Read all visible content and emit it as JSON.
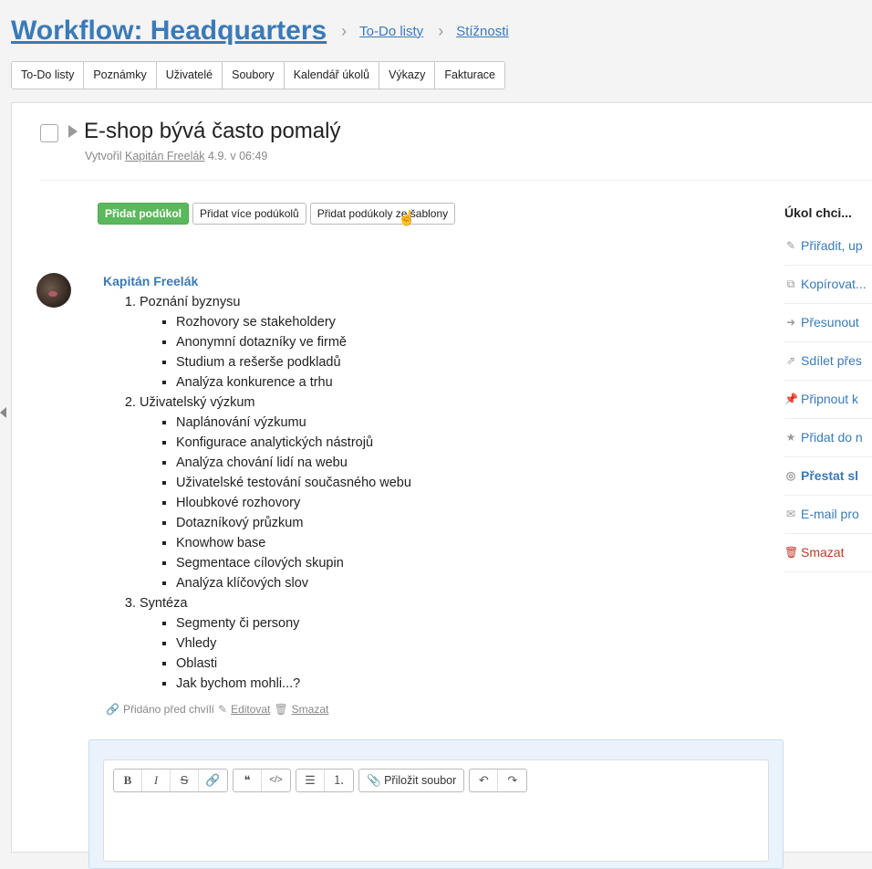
{
  "header": {
    "title": "Workflow: Headquarters",
    "breadcrumbs": [
      "To-Do listy",
      "Stížnosti"
    ]
  },
  "tabs": [
    "To-Do listy",
    "Poznámky",
    "Uživatelé",
    "Soubory",
    "Kalendář úkolů",
    "Výkazy",
    "Fakturace"
  ],
  "task": {
    "title": "E-shop bývá často pomalý",
    "created_label": "Vytvořil",
    "author": "Kapitán Freelák",
    "created_at": "4.9. v 06:49"
  },
  "subtask_buttons": {
    "add": "Přidat podúkol",
    "add_multiple": "Přidat více podúkolů",
    "add_template": "Přidat podúkoly ze šablony"
  },
  "comment": {
    "author": "Kapitán Freelák",
    "sections": [
      {
        "title": "Poznání byznysu",
        "items": [
          "Rozhovory se stakeholdery",
          "Anonymní dotazníky ve firmě",
          "Studium a rešerše podkladů",
          "Analýza konkurence a trhu"
        ]
      },
      {
        "title": "Uživatelský výzkum",
        "items": [
          "Naplánování výzkumu",
          "Konfigurace analytických nástrojů",
          "Analýza chování lidí na webu",
          "Uživatelské testování současného webu",
          "Hloubkové rozhovory",
          "Dotazníkový průzkum",
          "Knowhow base",
          "Segmentace cílových skupin",
          "Analýza klíčových slov"
        ]
      },
      {
        "title": "Syntéza",
        "items": [
          "Segmenty či persony",
          "Vhledy",
          "Oblasti",
          "Jak bychom mohli...?"
        ]
      }
    ],
    "added": "Přidáno před chvílí",
    "edit": "Editovat",
    "delete": "Smazat"
  },
  "editor": {
    "bold": "B",
    "italic": "I",
    "strike": "S",
    "link": "🔗",
    "quote": "❝",
    "code": "</>",
    "bullets": "☰",
    "numbers": "⒈",
    "attach": "Přiložit soubor",
    "undo": "↶",
    "redo": "↷"
  },
  "sidebar": {
    "title": "Úkol chci...",
    "items": [
      {
        "label": "Přiřadit, up",
        "icon": "pencil-icon",
        "glyph": "✎"
      },
      {
        "label": "Kopírovat...",
        "icon": "copy-icon",
        "glyph": "⧉"
      },
      {
        "label": "Přesunout",
        "icon": "arrow-right-icon",
        "glyph": "➜"
      },
      {
        "label": "Sdílet přes",
        "icon": "share-icon",
        "glyph": "⇗"
      },
      {
        "label": "Připnout k",
        "icon": "pin-icon",
        "glyph": "📌"
      },
      {
        "label": "Přidat do n",
        "icon": "star-icon",
        "glyph": "★"
      },
      {
        "label": "Přestat sl",
        "icon": "eye-slash-icon",
        "glyph": "◎"
      },
      {
        "label": "E-mail pro",
        "icon": "mail-icon",
        "glyph": "✉"
      },
      {
        "label": "Smazat",
        "icon": "trash-icon",
        "glyph": "🗑"
      }
    ]
  }
}
